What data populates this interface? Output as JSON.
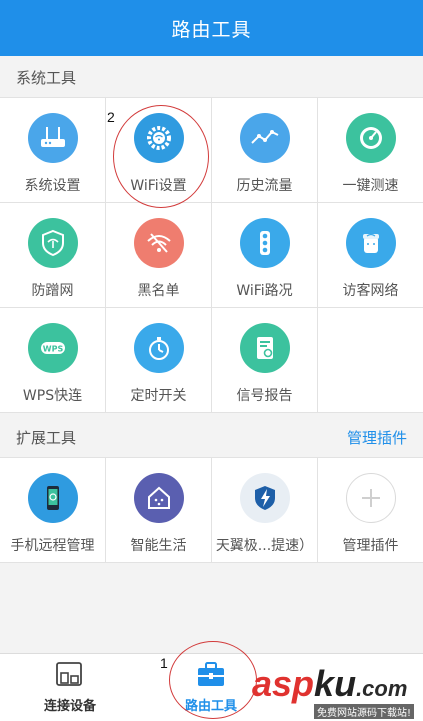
{
  "header": {
    "title": "路由工具"
  },
  "system_section": {
    "title": "系统工具"
  },
  "system_tools": [
    {
      "label": "系统设置",
      "icon": "router-icon",
      "color": "#4aa6ea"
    },
    {
      "label": "WiFi设置",
      "icon": "wifi-gear-icon",
      "color": "#2f9be0"
    },
    {
      "label": "历史流量",
      "icon": "line-chart-icon",
      "color": "#4aa6ea"
    },
    {
      "label": "一键测速",
      "icon": "speedometer-icon",
      "color": "#3cc29e"
    },
    {
      "label": "防蹭网",
      "icon": "shield-icon",
      "color": "#3cc29e"
    },
    {
      "label": "黑名单",
      "icon": "wifi-off-icon",
      "color": "#ef7d6f"
    },
    {
      "label": "WiFi路况",
      "icon": "traffic-light-icon",
      "color": "#3aa9ea"
    },
    {
      "label": "访客网络",
      "icon": "guest-icon",
      "color": "#3aa9ea"
    },
    {
      "label": "WPS快连",
      "icon": "wps-icon",
      "color": "#3cc29e"
    },
    {
      "label": "定时开关",
      "icon": "stopwatch-icon",
      "color": "#3aa9ea"
    },
    {
      "label": "信号报告",
      "icon": "report-icon",
      "color": "#3cc29e"
    }
  ],
  "extension_section": {
    "title": "扩展工具",
    "link": "管理插件"
  },
  "extension_tools": [
    {
      "label": "手机远程管理",
      "icon": "phone-icon",
      "color": "#2f9be0"
    },
    {
      "label": "智能生活",
      "icon": "smart-home-icon",
      "color": "#5a5fb0"
    },
    {
      "label": "天翼极...提速）",
      "icon": "lightning-shield-icon",
      "color": "#e8eef4"
    },
    {
      "label": "管理插件",
      "icon": "plus-icon",
      "color": "#ffffff"
    }
  ],
  "bottom_tabs": [
    {
      "label": "连接设备",
      "icon": "devices-icon"
    },
    {
      "label": "路由工具",
      "icon": "toolbox-icon",
      "active": true
    }
  ],
  "annotations": {
    "step1": "1",
    "step2": "2"
  },
  "watermark": {
    "logo_a": "asp",
    "logo_b": "ku",
    "logo_c": ".com",
    "subtitle": "免费网站源码下载站!"
  },
  "colors": {
    "accent": "#1f8fe9",
    "marker": "#d23b3b"
  }
}
